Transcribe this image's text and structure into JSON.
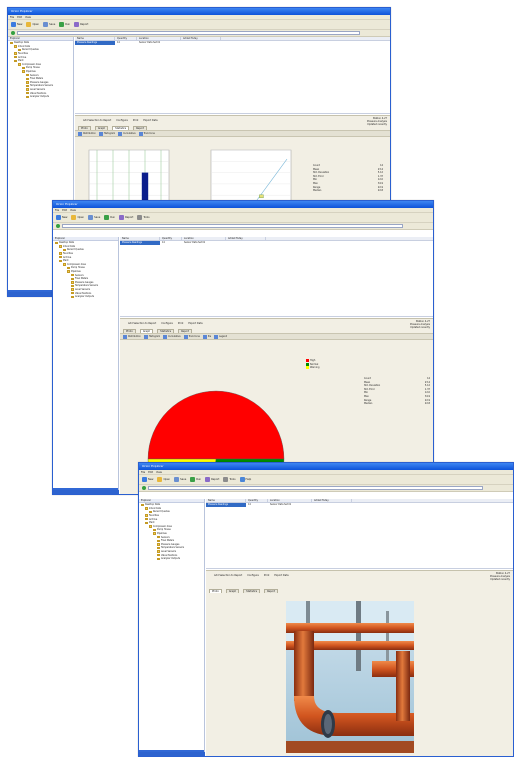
{
  "app": {
    "title": "Orion Explorer",
    "menus": [
      "File",
      "Edit",
      "View"
    ],
    "toolbar": [
      {
        "label": "New",
        "icon": "new-icon",
        "color": "#3b7be0"
      },
      {
        "label": "Open",
        "icon": "folder-icon",
        "color": "#e8b73a"
      },
      {
        "label": "Save",
        "icon": "save-icon",
        "color": "#6a8fd0"
      },
      {
        "label": "Run",
        "icon": "run-icon",
        "color": "#3aa047"
      },
      {
        "label": "Report",
        "icon": "report-icon",
        "color": "#8a6ac8"
      },
      {
        "label": "Tools",
        "icon": "tools-icon",
        "color": "#8c8c8c"
      },
      {
        "label": "Help",
        "icon": "help-icon",
        "color": "#4a86d8"
      }
    ]
  },
  "tree": {
    "header": "Explorer",
    "items": [
      {
        "label": "Desktop Data",
        "indent": 0
      },
      {
        "label": "Inbox Data",
        "indent": 1
      },
      {
        "label": "Recent Queries",
        "indent": 2
      },
      {
        "label": "Favorites",
        "indent": 1
      },
      {
        "label": "Archive",
        "indent": 1
      },
      {
        "label": "Plant",
        "indent": 1
      },
      {
        "label": "Compressor Area",
        "indent": 2
      },
      {
        "label": "Pump House",
        "indent": 3
      },
      {
        "label": "Pipelines",
        "indent": 3
      },
      {
        "label": "Sensors",
        "indent": 4
      },
      {
        "label": "Flow Meters",
        "indent": 4
      },
      {
        "label": "Pressure Gauges",
        "indent": 4
      },
      {
        "label": "Temperature Sensors",
        "indent": 4
      },
      {
        "label": "Level Sensors",
        "indent": 4
      },
      {
        "label": "Valve Positions",
        "indent": 4
      },
      {
        "label": "Analyzer Outputs",
        "indent": 4
      }
    ]
  },
  "list": {
    "columns": [
      "Name",
      "Quantity",
      "Location",
      "Added Today"
    ],
    "rows": [
      {
        "name": "Pressure Readings",
        "qty": "14",
        "loc": "Sensor Data Set 01",
        "added": ""
      }
    ]
  },
  "panel": {
    "actions": [
      "Add Selection to Report",
      "Configure",
      "Print",
      "Export Data"
    ],
    "info": [
      "Station 4-27",
      "Pressure Analysis",
      "Updated recently"
    ],
    "tabs": [
      "Photo",
      "Graph",
      "Statistics",
      "Report"
    ],
    "chart_tools": [
      "Distribution",
      "Histogram",
      "Cumulative",
      "Trend Line",
      "Pie",
      "Legend"
    ]
  },
  "stats": {
    "labels": [
      "Count",
      "Mean",
      "Std. Deviation",
      "Std. Error",
      "Min",
      "Max",
      "Range",
      "Median"
    ],
    "values": [
      "14",
      "23.4",
      "5.12",
      "1.37",
      "12.0",
      "34.9",
      "22.9",
      "22.8"
    ]
  },
  "chart_data": [
    {
      "type": "bar",
      "categories": [
        "A",
        "B",
        "C",
        "D",
        "E"
      ],
      "values": [
        0,
        0,
        0,
        8,
        0
      ],
      "ylim": [
        0,
        10
      ],
      "grid": true
    },
    {
      "type": "scatter",
      "x": [
        2.0,
        3.1,
        4.0,
        4.6,
        5.2,
        6.3
      ],
      "y": [
        1.6,
        2.7,
        3.3,
        4.2,
        4.8,
        5.9
      ],
      "xlim": [
        0,
        10
      ],
      "ylim": [
        0,
        10
      ],
      "grid": true
    },
    {
      "type": "pie",
      "categories": [
        "High",
        "Normal",
        "Warning"
      ],
      "values": [
        50,
        27.5,
        22.5
      ],
      "colors": [
        "#ff0000",
        "#008a00",
        "#ffff00"
      ],
      "legend": "right"
    }
  ],
  "photo": {
    "caption": "Pipeline Valve Assembly"
  }
}
